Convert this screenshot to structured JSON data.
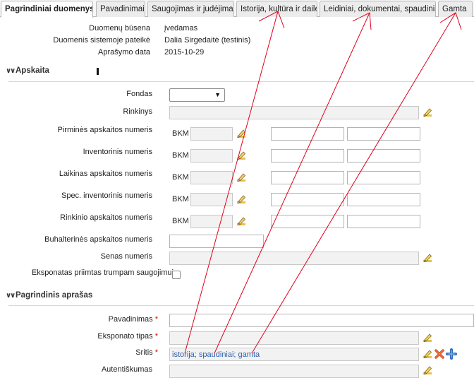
{
  "tabs": [
    {
      "label": "Pagrindiniai duomenys",
      "active": true
    },
    {
      "label": "Pavadinimai"
    },
    {
      "label": "Saugojimas ir judėjimas"
    },
    {
      "label": "Istorija, kultūra ir dailė"
    },
    {
      "label": "Leidiniai, dokumentai, spaudiniai"
    },
    {
      "label": "Gamta"
    }
  ],
  "info": {
    "status_label": "Duomenų būsena",
    "status_value": "įvedamas",
    "submitter_label": "Duomenis sistemoje pateikė",
    "submitter_value": "Dalia Sirgedaitė (testinis)",
    "date_label": "Aprašymo data",
    "date_value": "2015-10-29"
  },
  "sections": {
    "accounting": "Apskaita",
    "main_description": "Pagrindinis aprašas"
  },
  "accounting": {
    "fondas_label": "Fondas",
    "rinkinys_label": "Rinkinys",
    "primary_label": "Pirminės apskaitos numeris",
    "inventory_label": "Inventorinis numeris",
    "temporary_label": "Laikinas apskaitos numeris",
    "spec_inventory_label": "Spec. inventorinis numeris",
    "collection_label": "Rinkinio apskaitos numeris",
    "bookkeeping_label": "Buhalterinės apskaitos numeris",
    "old_number_label": "Senas numeris",
    "short_term_label": "Eksponatas priimtas trumpam saugojimui",
    "prefix": "BKM"
  },
  "main": {
    "name_label": "Pavadinimas",
    "type_label": "Eksponato tipas",
    "field_label": "Sritis",
    "field_value": "istorija; spaudiniai; gamta",
    "authenticity_label": "Autentiškumas",
    "required_mark": "*"
  },
  "colors": {
    "accent_link": "#2b5fa8",
    "required": "#dd0000",
    "annotation": "#e0001a",
    "delete": "#d24a1c",
    "add": "#2f6db8"
  },
  "icons": {
    "edit": "pencil-icon",
    "delete": "delete-x-icon",
    "add": "plus-icon",
    "toggle": "double-chevron-down-icon"
  }
}
